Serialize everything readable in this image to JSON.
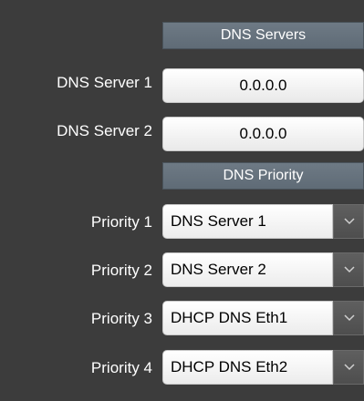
{
  "dns_servers": {
    "header": "DNS Servers",
    "servers": [
      {
        "label": "DNS Server 1",
        "value": "0.0.0.0"
      },
      {
        "label": "DNS Server 2",
        "value": "0.0.0.0"
      }
    ]
  },
  "dns_priority": {
    "header": "DNS Priority",
    "priorities": [
      {
        "label": "Priority 1",
        "selected": "DNS Server 1"
      },
      {
        "label": "Priority 2",
        "selected": "DNS Server 2"
      },
      {
        "label": "Priority 3",
        "selected": "DHCP DNS Eth1"
      },
      {
        "label": "Priority 4",
        "selected": "DHCP DNS Eth2"
      }
    ]
  },
  "icons": {
    "dropdown": "chevron-down-icon"
  },
  "colors": {
    "background": "#3c3c3c",
    "header_bg": "#66727d",
    "field_bg": "#ffffff",
    "label_text": "#ffffff"
  }
}
